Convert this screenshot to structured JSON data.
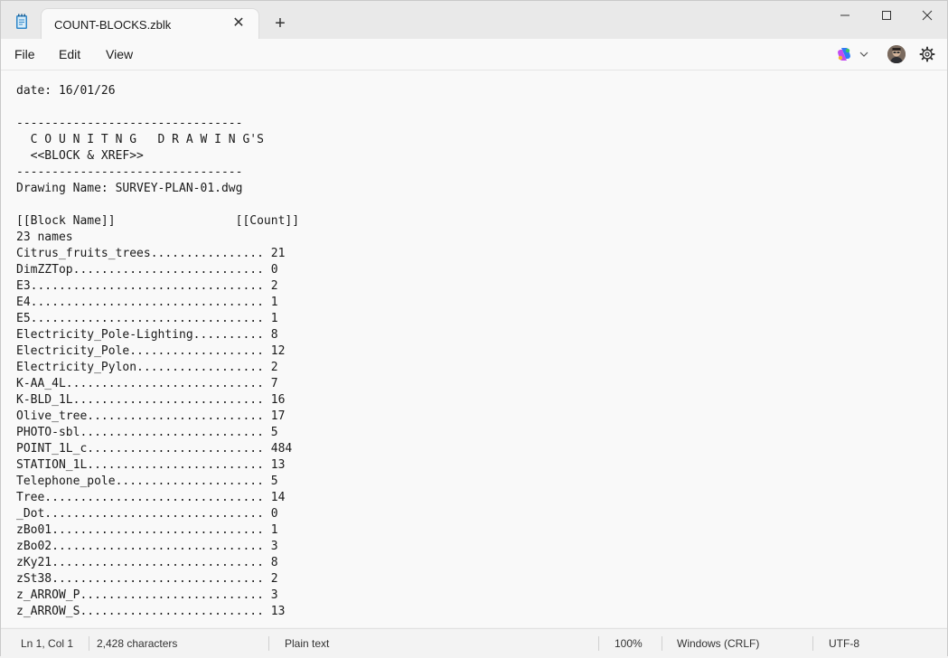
{
  "titlebar": {
    "tab_title": "COUNT-BLOCKS.zblk",
    "tab_close_glyph": "✕",
    "new_tab_glyph": "+"
  },
  "menu": {
    "items": [
      {
        "label": "File"
      },
      {
        "label": "Edit"
      },
      {
        "label": "View"
      }
    ]
  },
  "editor": {
    "lines": [
      "date: 16/01/26",
      "",
      "--------------------------------",
      "  C O U N I T N G   D R A W I N G'S",
      "  <<BLOCK & XREF>>",
      "--------------------------------",
      "Drawing Name: SURVEY-PLAN-01.dwg",
      "",
      "[[Block Name]]                 [[Count]]",
      "23 names",
      "Citrus_fruits_trees................ 21",
      "DimZZTop........................... 0",
      "E3................................. 2",
      "E4................................. 1",
      "E5................................. 1",
      "Electricity_Pole-Lighting.......... 8",
      "Electricity_Pole................... 12",
      "Electricity_Pylon.................. 2",
      "K-AA_4L............................ 7",
      "K-BLD_1L........................... 16",
      "Olive_tree......................... 17",
      "PHOTO-sbl.......................... 5",
      "POINT_1L_c......................... 484",
      "STATION_1L......................... 13",
      "Telephone_pole..................... 5",
      "Tree............................... 14",
      "_Dot............................... 0",
      "zBo01.............................. 1",
      "zBo02.............................. 3",
      "zKy21.............................. 8",
      "zSt38.............................. 2",
      "z_ARROW_P.......................... 3",
      "z_ARROW_S.......................... 13"
    ]
  },
  "status": {
    "position": "Ln 1, Col 1",
    "characters": "2,428 characters",
    "format": "Plain text",
    "zoom": "100%",
    "line_ending": "Windows (CRLF)",
    "encoding": "UTF-8"
  },
  "colors": {
    "copilot_gradient": [
      "#2f7bf5",
      "#c24cf0",
      "#f5b02f",
      "#3bc46a"
    ]
  },
  "icons": {
    "app": "notepad-icon",
    "copilot": "copilot-icon",
    "settings": "gear-icon",
    "minimize": "minimize-icon",
    "maximize": "maximize-icon",
    "close": "close-icon"
  }
}
